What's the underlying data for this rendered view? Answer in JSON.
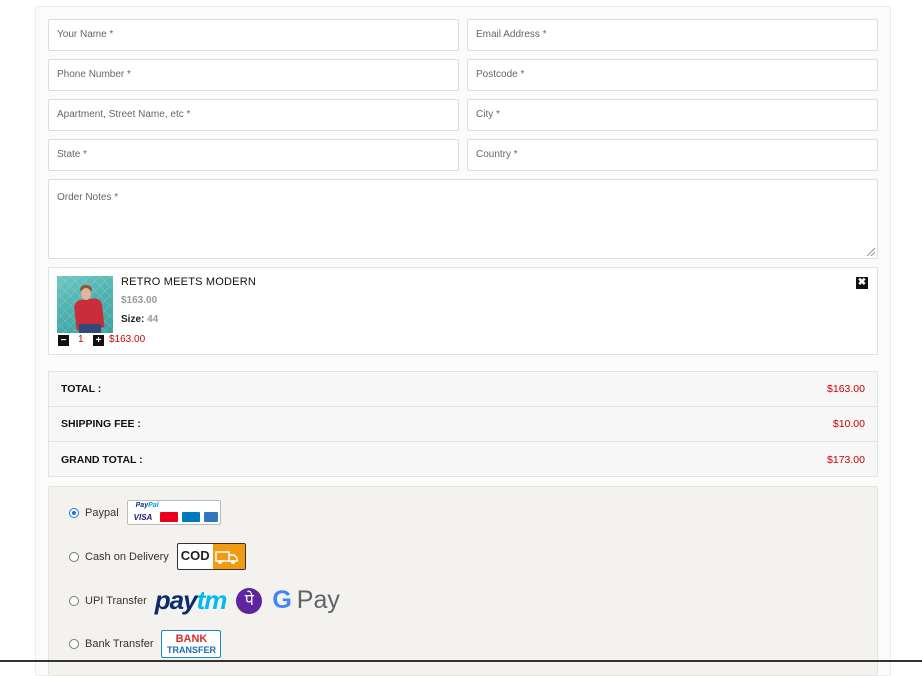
{
  "form": {
    "name_placeholder": "Your Name *",
    "email_placeholder": "Email Address *",
    "phone_placeholder": "Phone Number *",
    "postcode_placeholder": "Postcode *",
    "address_placeholder": "Apartment, Street Name, etc *",
    "city_placeholder": "City *",
    "state_placeholder": "State *",
    "country_placeholder": "Country *",
    "notes_placeholder": "Order Notes *"
  },
  "cart_item": {
    "name": "RETRO MEETS MODERN",
    "price": "$163.00",
    "size_label": "Size:",
    "size_value": "44",
    "quantity": "1",
    "line_total": "$163.00",
    "remove_symbol": "✖",
    "minus_symbol": "−",
    "plus_symbol": "+"
  },
  "totals": {
    "total_label": "TOTAL :",
    "total_value": "$163.00",
    "shipping_label": "SHIPPING FEE :",
    "shipping_value": "$10.00",
    "grand_label": "GRAND TOTAL :",
    "grand_value": "$173.00"
  },
  "payment": {
    "options": [
      {
        "label": "Paypal",
        "selected": true,
        "logo": "paypal-cards-logo"
      },
      {
        "label": "Cash on Delivery",
        "selected": false,
        "logo": "cod-logo"
      },
      {
        "label": "UPI Transfer",
        "selected": false,
        "logo": "upi-logos"
      },
      {
        "label": "Bank Transfer",
        "selected": false,
        "logo": "bank-transfer-logo"
      }
    ],
    "paypal_text_1": "Pay",
    "paypal_text_2": "Pal",
    "visa_text": "VISA",
    "cod_text": "COD",
    "paytm_text_1": "pay",
    "paytm_text_2": "tm",
    "phonepe_text": "पे",
    "gpay_g": "G",
    "gpay_text": "Pay",
    "bank_text_1": "BANK",
    "bank_text_2": "TRANSFER"
  },
  "colors": {
    "accent_red": "#cc0000",
    "radio_blue": "#1a73e8"
  }
}
